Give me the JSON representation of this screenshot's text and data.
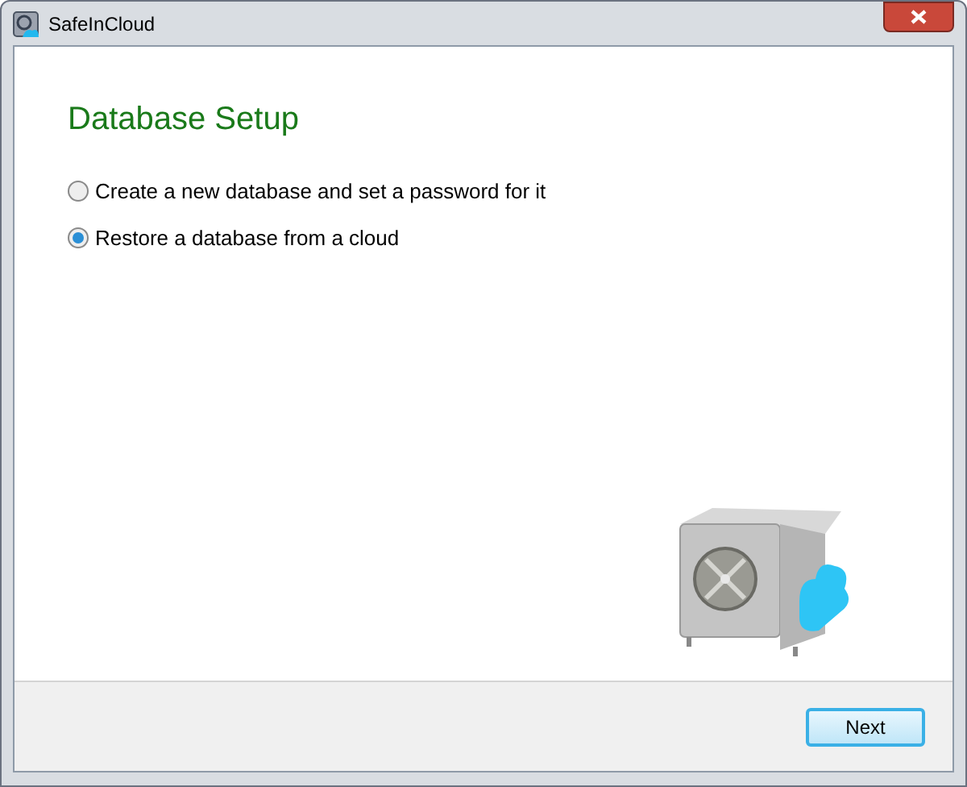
{
  "window": {
    "title": "SafeInCloud"
  },
  "heading": "Database Setup",
  "options": [
    {
      "label": "Create a new database and set a password for it",
      "selected": false
    },
    {
      "label": "Restore a database from a cloud",
      "selected": true
    }
  ],
  "buttons": [
    "Next"
  ]
}
